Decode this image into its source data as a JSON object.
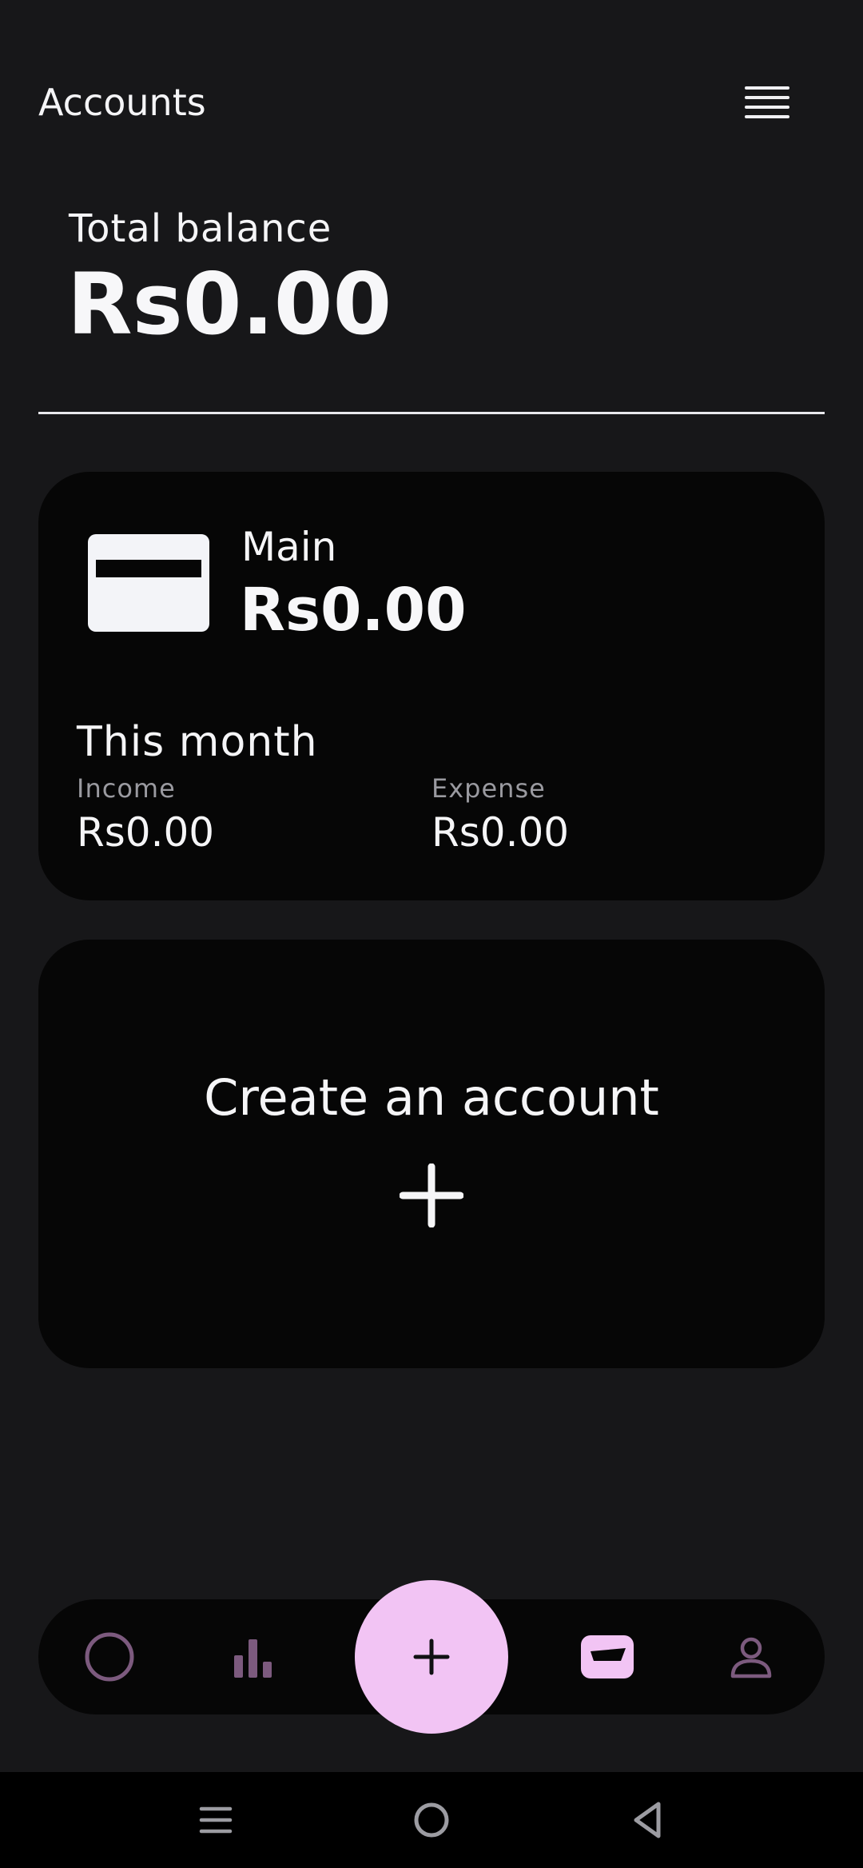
{
  "header": {
    "title": "Accounts",
    "menu_icon": "menu-icon"
  },
  "summary": {
    "total_label": "Total balance",
    "total_value": "Rs0.00"
  },
  "account_card": {
    "icon": "credit-card-icon",
    "name": "Main",
    "balance": "Rs0.00",
    "month_title": "This month",
    "income_label": "Income",
    "income_value": "Rs0.00",
    "expense_label": "Expense",
    "expense_value": "Rs0.00"
  },
  "create_card": {
    "title": "Create an account",
    "icon": "plus-icon"
  },
  "bottom_nav": {
    "items": [
      {
        "icon": "home-circle-icon",
        "active": false
      },
      {
        "icon": "stats-bar-icon",
        "active": false
      },
      {
        "icon": "wallet-icon",
        "active": true
      },
      {
        "icon": "profile-icon",
        "active": false
      }
    ],
    "fab_icon": "plus-icon"
  },
  "colors": {
    "background": "#171719",
    "card": "#060606",
    "accent": "#f2c4f4",
    "muted_accent": "#7c5a7e",
    "text": "#f5f5f7",
    "secondary_text": "#9a9aa0"
  }
}
